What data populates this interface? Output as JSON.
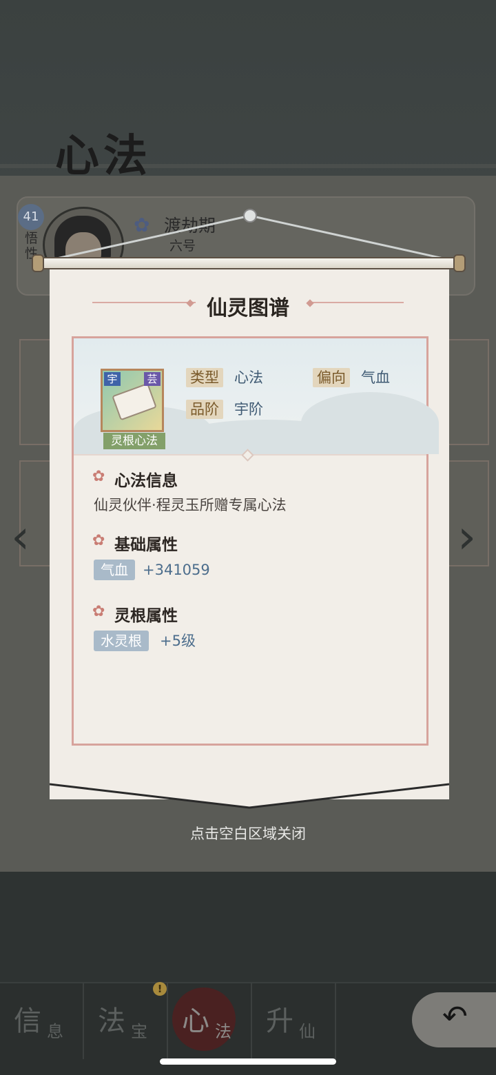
{
  "background": {
    "page_title": "心法",
    "level": "41",
    "wuxing_label": "悟性",
    "realm": {
      "name": "渡劫期",
      "sub": "六号"
    }
  },
  "popup": {
    "title": "仙灵图谱",
    "skill": {
      "corner_left": "宇",
      "corner_right": "芸",
      "tag": "灵根心法",
      "type_label": "类型",
      "type_value": "心法",
      "bias_label": "偏向",
      "bias_value": "气血",
      "grade_label": "品阶",
      "grade_value": "宇阶"
    },
    "sections": {
      "info_title": "心法信息",
      "info_desc": "仙灵伙伴·程灵玉所赠专属心法",
      "base_title": "基础属性",
      "base_attr_name": "气血",
      "base_attr_value": "+341059",
      "root_title": "灵根属性",
      "root_attr_name": "水灵根",
      "root_attr_value": "+5级"
    },
    "close_hint": "点击空白区域关闭"
  },
  "tabs": [
    {
      "big": "信",
      "small": "息"
    },
    {
      "big": "法",
      "small": "宝"
    },
    {
      "big": "心",
      "small": "法"
    },
    {
      "big": "升",
      "small": "仙"
    }
  ],
  "tab_alert": "!"
}
